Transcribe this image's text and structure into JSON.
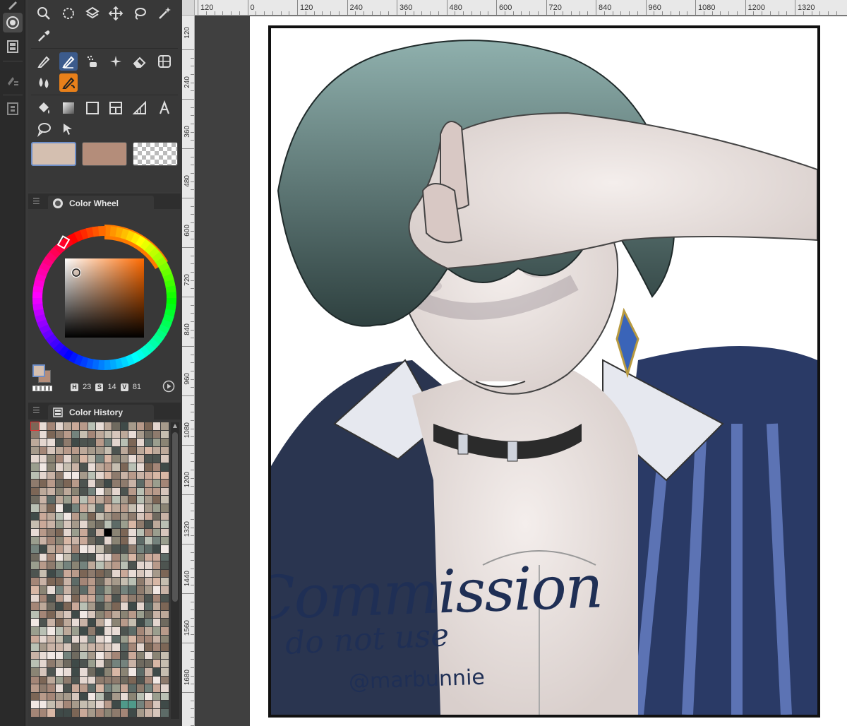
{
  "panels": {
    "color_wheel": {
      "title": "Color Wheel"
    },
    "color_history": {
      "title": "Color History"
    }
  },
  "color": {
    "main_hex": "#d4bfb0",
    "sub_hex": "#b48d7a",
    "h_key": "H",
    "h": "23",
    "s_key": "S",
    "s": "14",
    "v_key": "V",
    "v": "81"
  },
  "ruler": {
    "top": [
      "120",
      "0",
      "120",
      "240",
      "360",
      "480",
      "600",
      "720",
      "840",
      "960",
      "1080",
      "1200",
      "1320"
    ],
    "left": [
      "120",
      "240",
      "360",
      "480",
      "600",
      "720",
      "840",
      "960",
      "1080",
      "1200",
      "1320",
      "1440",
      "1560",
      "1680"
    ]
  },
  "watermark": {
    "line1": "Commission",
    "line2": "do not use",
    "line3": "@marbunnie"
  },
  "colors": {
    "accent_blue": "#3c5b8c",
    "accent_orange": "#e8801a",
    "panel_bg": "#383838"
  }
}
